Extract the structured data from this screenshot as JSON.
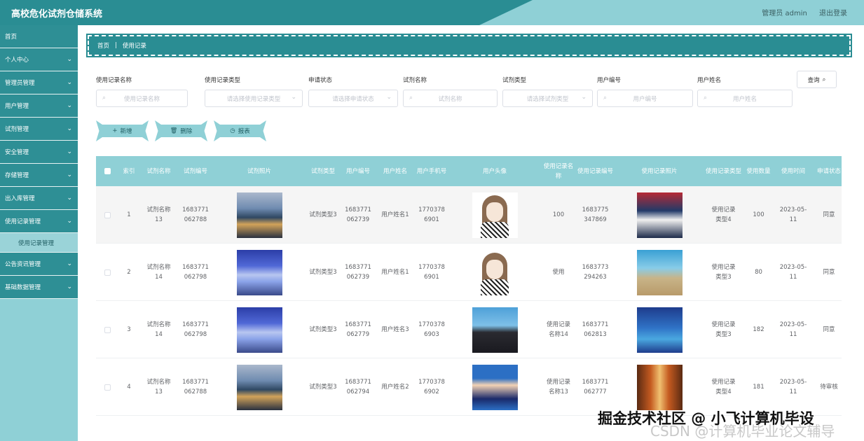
{
  "app": {
    "title": "高校危化试剂仓储系统",
    "user_label": "管理员 admin",
    "logout_label": "退出登录"
  },
  "sidebar": {
    "items": [
      {
        "label": "首页",
        "has_arrow": false
      },
      {
        "label": "个人中心",
        "has_arrow": true
      },
      {
        "label": "管理员管理",
        "has_arrow": true
      },
      {
        "label": "用户管理",
        "has_arrow": true
      },
      {
        "label": "试剂管理",
        "has_arrow": true
      },
      {
        "label": "安全管理",
        "has_arrow": true
      },
      {
        "label": "存储管理",
        "has_arrow": true
      },
      {
        "label": "出入库管理",
        "has_arrow": true
      },
      {
        "label": "使用记录管理",
        "has_arrow": true
      }
    ],
    "sub_item": "使用记录管理",
    "items_after": [
      {
        "label": "公告资讯管理",
        "has_arrow": true
      },
      {
        "label": "基础数据管理",
        "has_arrow": true
      }
    ]
  },
  "breadcrumb": {
    "home": "首页",
    "separator": "|",
    "current": "使用记录"
  },
  "filters": [
    {
      "label": "使用记录名称",
      "placeholder": "使用记录名称",
      "type": "input"
    },
    {
      "label": "使用记录类型",
      "placeholder": "请选择使用记录类型",
      "type": "select"
    },
    {
      "label": "申请状态",
      "placeholder": "请选择申请状态",
      "type": "select"
    },
    {
      "label": "试剂名称",
      "placeholder": "试剂名称",
      "type": "input"
    },
    {
      "label": "试剂类型",
      "placeholder": "请选择试剂类型",
      "type": "select"
    },
    {
      "label": "用户编号",
      "placeholder": "用户编号",
      "type": "input"
    },
    {
      "label": "用户姓名",
      "placeholder": "用户姓名",
      "type": "input"
    }
  ],
  "search_button": "查询",
  "actions": {
    "add": "新增",
    "delete": "删除",
    "report": "报表"
  },
  "table": {
    "headers": [
      "索引",
      "试剂名称",
      "试剂编号",
      "试剂照片",
      "试剂类型",
      "用户编号",
      "用户姓名",
      "用户手机号",
      "用户头像",
      "使用记录名称",
      "使用记录编号",
      "使用记录照片",
      "使用记录类型",
      "使用数量",
      "使用时间",
      "申请状态"
    ],
    "rows": [
      {
        "index": "1",
        "reagent_name": "试剂名称13",
        "reagent_no": "1683771062788",
        "reagent_photo": "city-icon",
        "reagent_type": "试剂类型3",
        "user_no": "1683771062739",
        "user_name": "用户姓名1",
        "phone": "17703786901",
        "avatar": "girl-avatar-icon",
        "record_name": "100",
        "record_no": "1683775347869",
        "record_photo": "team-icon",
        "record_type": "使用记录类型4",
        "qty": "100",
        "time": "2023-05-11",
        "status": "同意"
      },
      {
        "index": "2",
        "reagent_name": "试剂名称14",
        "reagent_no": "1683771062798",
        "reagent_photo": "sky-icon",
        "reagent_type": "试剂类型3",
        "user_no": "1683771062739",
        "user_name": "用户姓名1",
        "phone": "17703786901",
        "avatar": "girl-avatar-icon",
        "record_name": "使用",
        "record_no": "1683773294263",
        "record_photo": "beach-icon",
        "record_type": "使用记录类型3",
        "qty": "80",
        "time": "2023-05-11",
        "status": "同意"
      },
      {
        "index": "3",
        "reagent_name": "试剂名称14",
        "reagent_no": "1683771062798",
        "reagent_photo": "sky-icon",
        "reagent_type": "试剂类型3",
        "user_no": "1683771062779",
        "user_name": "用户姓名3",
        "phone": "17703786903",
        "avatar": "boy-photo-icon",
        "record_name": "使用记录名称14",
        "record_no": "1683771062813",
        "record_photo": "ocean-icon",
        "record_type": "使用记录类型3",
        "qty": "182",
        "time": "2023-05-11",
        "status": "同意"
      },
      {
        "index": "4",
        "reagent_name": "试剂名称13",
        "reagent_no": "1683771062788",
        "reagent_photo": "city-icon",
        "reagent_type": "试剂类型3",
        "user_no": "1683771062794",
        "user_name": "用户姓名2",
        "phone": "17703786902",
        "avatar": "conan-avatar-icon",
        "record_name": "使用记录名称13",
        "record_no": "1683771062777",
        "record_photo": "hall-icon",
        "record_type": "使用记录类型4",
        "qty": "181",
        "time": "2023-05-11",
        "status": "待审核"
      }
    ]
  },
  "watermark": {
    "primary": "掘金技术社区 @ 小飞计算机毕设",
    "secondary": "CSDN @计算机毕业论文辅导"
  },
  "colors": {
    "primary": "#2a8d93",
    "light": "#8fd0d6"
  }
}
